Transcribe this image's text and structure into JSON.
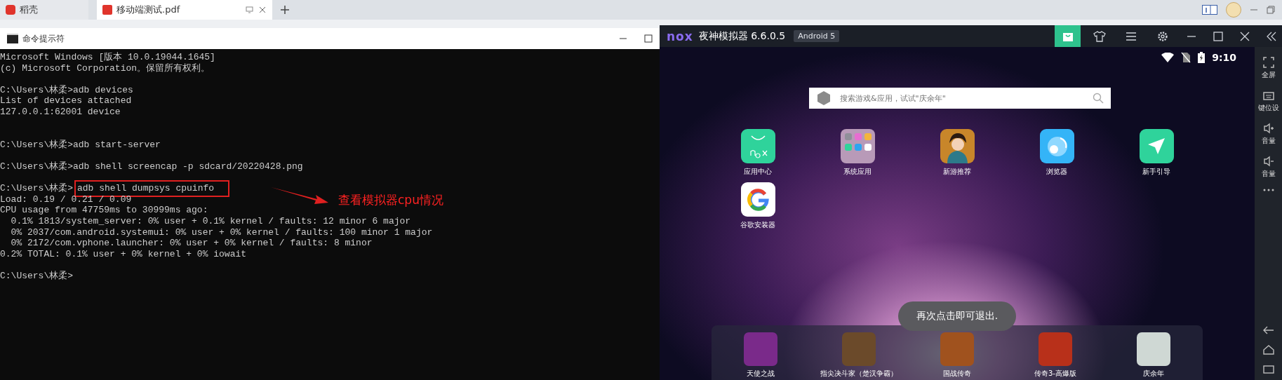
{
  "tabs": [
    {
      "label": "稻壳",
      "selected": false,
      "kind": "docer"
    },
    {
      "label": "移动端测试.pdf",
      "selected": true,
      "kind": "pdf"
    }
  ],
  "cmd": {
    "title": "命令提示符",
    "lines": [
      {
        "kind": "text",
        "text": "Microsoft Windows [版本 10.0.19044.1645]"
      },
      {
        "kind": "text",
        "text": "(c) Microsoft Corporation。保留所有权利。"
      },
      {
        "kind": "blank"
      },
      {
        "kind": "prompt",
        "prompt": "C:\\Users\\林柔>",
        "command": "adb devices",
        "highlighted": false
      },
      {
        "kind": "text",
        "text": "List of devices attached"
      },
      {
        "kind": "text",
        "text": "127.0.0.1:62001 device"
      },
      {
        "kind": "blank"
      },
      {
        "kind": "blank"
      },
      {
        "kind": "prompt",
        "prompt": "C:\\Users\\林柔>",
        "command": "adb start-server",
        "highlighted": false
      },
      {
        "kind": "blank"
      },
      {
        "kind": "prompt",
        "prompt": "C:\\Users\\林柔>",
        "command": "adb shell screencap -p sdcard/20220428.png",
        "highlighted": false
      },
      {
        "kind": "blank"
      },
      {
        "kind": "prompt",
        "prompt": "C:\\Users\\林柔>",
        "command": "adb shell dumpsys cpuinfo",
        "highlighted": true
      },
      {
        "kind": "text",
        "text": "Load: 0.19 / 0.21 / 0.09"
      },
      {
        "kind": "text",
        "text": "CPU usage from 47759ms to 30999ms ago:"
      },
      {
        "kind": "text",
        "text": "  0.1% 1813/system_server: 0% user + 0.1% kernel / faults: 12 minor 6 major"
      },
      {
        "kind": "text",
        "text": "  0% 2037/com.android.systemui: 0% user + 0% kernel / faults: 100 minor 1 major"
      },
      {
        "kind": "text",
        "text": "  0% 2172/com.vphone.launcher: 0% user + 0% kernel / faults: 8 minor"
      },
      {
        "kind": "text",
        "text": "0.2% TOTAL: 0.1% user + 0% kernel + 0% iowait"
      },
      {
        "kind": "blank"
      },
      {
        "kind": "prompt",
        "prompt": "C:\\Users\\林柔>"
      }
    ]
  },
  "annotation": {
    "text": "查看模拟器cpu情况"
  },
  "emulator": {
    "logo": "nox",
    "title": "夜神模拟器 6.6.0.5",
    "badge": "Android 5",
    "tools": [
      {
        "kind": "store",
        "selected": true
      },
      {
        "kind": "skin",
        "selected": false
      },
      {
        "kind": "menu",
        "selected": false
      },
      {
        "kind": "settings",
        "selected": false
      }
    ],
    "time": "9:10",
    "search": {
      "placeholder": "搜索游戏&应用，试试\"庆余年\""
    },
    "apps": [
      {
        "label": "应用中心",
        "kind": "appcenter"
      },
      {
        "label": "系统应用",
        "kind": "folder"
      },
      {
        "label": "新游推荐",
        "kind": "game"
      },
      {
        "label": "浏览器",
        "kind": "browser"
      },
      {
        "label": "新手引导",
        "kind": "guide"
      },
      {
        "label": "谷歌安装器",
        "kind": "google"
      }
    ],
    "toast": "再次点击即可退出.",
    "dock": [
      {
        "label": "天使之战",
        "color": "#7a2a8a"
      },
      {
        "label": "指尖决斗家（楚汉争霸）",
        "color": "#6b4a2a"
      },
      {
        "label": "国战传奇",
        "color": "#a0521e"
      },
      {
        "label": "传奇3-高爆版",
        "color": "#b8301a"
      },
      {
        "label": "庆余年",
        "color": "#cfd8d4"
      }
    ],
    "sidebar": [
      {
        "label": "全屏",
        "kind": "fullscreen"
      },
      {
        "label": "键位设",
        "kind": "keyboard"
      },
      {
        "label": "音量",
        "kind": "volup"
      },
      {
        "label": "音量",
        "kind": "voldown"
      },
      {
        "kind": "more"
      }
    ]
  }
}
